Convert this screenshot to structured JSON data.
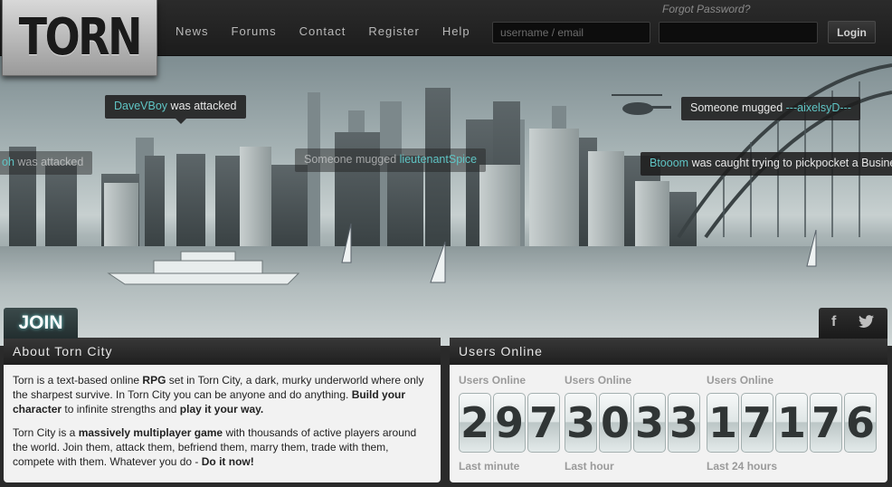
{
  "header": {
    "logo_text": "TORN",
    "nav": [
      "News",
      "Forums",
      "Contact",
      "Register",
      "Help"
    ],
    "forgot_password": "Forgot Password?",
    "username_placeholder": "username / email",
    "password_placeholder": "",
    "login_label": "Login"
  },
  "hero": {
    "events": [
      {
        "link": "DaveVBoy",
        "text": " was attacked",
        "faded": false
      },
      {
        "link": "oh",
        "text": " was attacked",
        "faded": true
      },
      {
        "text": "Someone mugged ",
        "link": "lieutenantSpice",
        "faded": true
      },
      {
        "text": "Someone mugged ",
        "link": "---aixelsyD---",
        "faded": false
      },
      {
        "link": "Btooom",
        "text": " was caught trying to pickpocket a Business",
        "faded": false
      }
    ]
  },
  "join": {
    "label": "JOIN"
  },
  "social": {
    "facebook_icon": "f",
    "twitter_icon": "twitter-bird"
  },
  "about": {
    "title": "About Torn City",
    "p1_a": "Torn is a text-based online ",
    "p1_b": "RPG",
    "p1_c": " set in Torn City, a dark, murky underworld where only the sharpest survive. In Torn City you can be anyone and do anything. ",
    "p1_d": "Build your character",
    "p1_e": " to infinite strengths and ",
    "p1_f": "play it your way.",
    "p2_a": "Torn City is a ",
    "p2_b": "massively multiplayer game",
    "p2_c": " with thousands of active players around the world. Join them, attack them, befriend them, marry them, trade with them, compete with them. Whatever you do - ",
    "p2_d": "Do it now!"
  },
  "users_online": {
    "title": "Users Online",
    "counters": [
      {
        "top": "Users Online",
        "value": "297",
        "bottom": "Last minute"
      },
      {
        "top": "Users Online",
        "value": "3033",
        "bottom": "Last hour"
      },
      {
        "top": "Users Online",
        "value": "17176",
        "bottom": "Last 24 hours"
      }
    ]
  },
  "colors": {
    "accent": "#5fc4c4",
    "header_bg": "#1c1c1c",
    "panel_bg": "#f2f2f2"
  }
}
